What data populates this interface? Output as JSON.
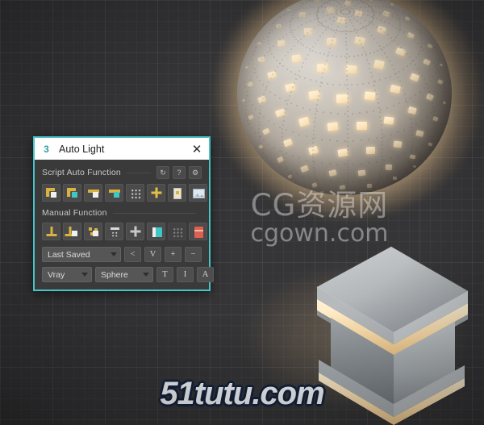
{
  "viewport": {
    "background_color": "#353537",
    "grid_color": "#3f3f41"
  },
  "scene": {
    "sphere": {
      "name": "glowing-panel-sphere",
      "material": "metal-with-emissive-panels",
      "panel_color": "#ffe7bd",
      "body_color": "#c9c3ba",
      "glow_color": "#ffd6a0"
    },
    "pedestal": {
      "name": "metal-pedestal",
      "material": "brushed-metal",
      "light_strip_color": "#ffe3b0",
      "body_color": "#b9bcbe"
    }
  },
  "watermarks": {
    "cg": {
      "line1": "CG资源网",
      "line2": "cgown.com",
      "logo_color": "#e8a020",
      "text_color": "#e8e8e8"
    },
    "tutu": {
      "text": "51tutu.com",
      "fill_color": "#f4f7fb",
      "outline_color": "#16233d"
    }
  },
  "dialog": {
    "accent_color": "#49c3c8",
    "titlebar": {
      "app_icon": "3dsmax-3-icon",
      "app_icon_text": "3",
      "title": "Auto Light",
      "close_label": "✕"
    },
    "sections": [
      {
        "id": "script-auto-function",
        "title": "Script Auto Function",
        "mini_buttons": [
          {
            "name": "refresh-button",
            "glyph": "↻"
          },
          {
            "name": "help-button",
            "glyph": "?"
          },
          {
            "name": "settings-button",
            "glyph": "⚙"
          }
        ],
        "buttons": [
          {
            "name": "auto-light-corner-white-button",
            "icon": "corner-white-icon"
          },
          {
            "name": "auto-light-corner-teal-button",
            "icon": "corner-teal-icon"
          },
          {
            "name": "auto-light-bar-white-button",
            "icon": "bar-white-icon"
          },
          {
            "name": "auto-light-bar-teal-button",
            "icon": "bar-teal-icon"
          },
          {
            "name": "auto-light-grid-button",
            "icon": "dot-grid-icon"
          },
          {
            "name": "auto-light-add-button",
            "icon": "plus-icon"
          },
          {
            "name": "auto-light-card-button",
            "icon": "card-icon"
          },
          {
            "name": "auto-light-image-button",
            "icon": "picture-icon"
          }
        ]
      },
      {
        "id": "manual-function",
        "title": "Manual Function",
        "buttons": [
          {
            "name": "manual-lamp-button",
            "icon": "lamp-icon"
          },
          {
            "name": "manual-lamp-white-button",
            "icon": "lamp-white-square-icon"
          },
          {
            "name": "manual-scatter-button",
            "icon": "scatter-icon"
          },
          {
            "name": "manual-rake-button",
            "icon": "rake-icon"
          },
          {
            "name": "manual-move-button",
            "icon": "move-gizmo-icon"
          },
          {
            "name": "manual-bar-button",
            "icon": "teal-bar-icon"
          },
          {
            "name": "manual-grid-button",
            "icon": "dot-grid-icon"
          },
          {
            "name": "manual-delete-button",
            "icon": "delete-icon"
          }
        ]
      }
    ],
    "controls": {
      "preset_dropdown": {
        "name": "preset-dropdown",
        "value": "Last Saved"
      },
      "preset_buttons": [
        {
          "name": "preset-prev-button",
          "label": "<"
        },
        {
          "name": "preset-view-button",
          "label": "V"
        },
        {
          "name": "preset-add-button",
          "label": "+"
        },
        {
          "name": "preset-remove-button",
          "label": "−"
        }
      ],
      "renderer_dropdown": {
        "name": "renderer-dropdown",
        "value": "Vray"
      },
      "shape_dropdown": {
        "name": "shape-dropdown",
        "value": "Sphere"
      },
      "mode_buttons": [
        {
          "name": "mode-t-button",
          "label": "T"
        },
        {
          "name": "mode-i-button",
          "label": "I"
        },
        {
          "name": "mode-a-button",
          "label": "A"
        }
      ]
    }
  }
}
